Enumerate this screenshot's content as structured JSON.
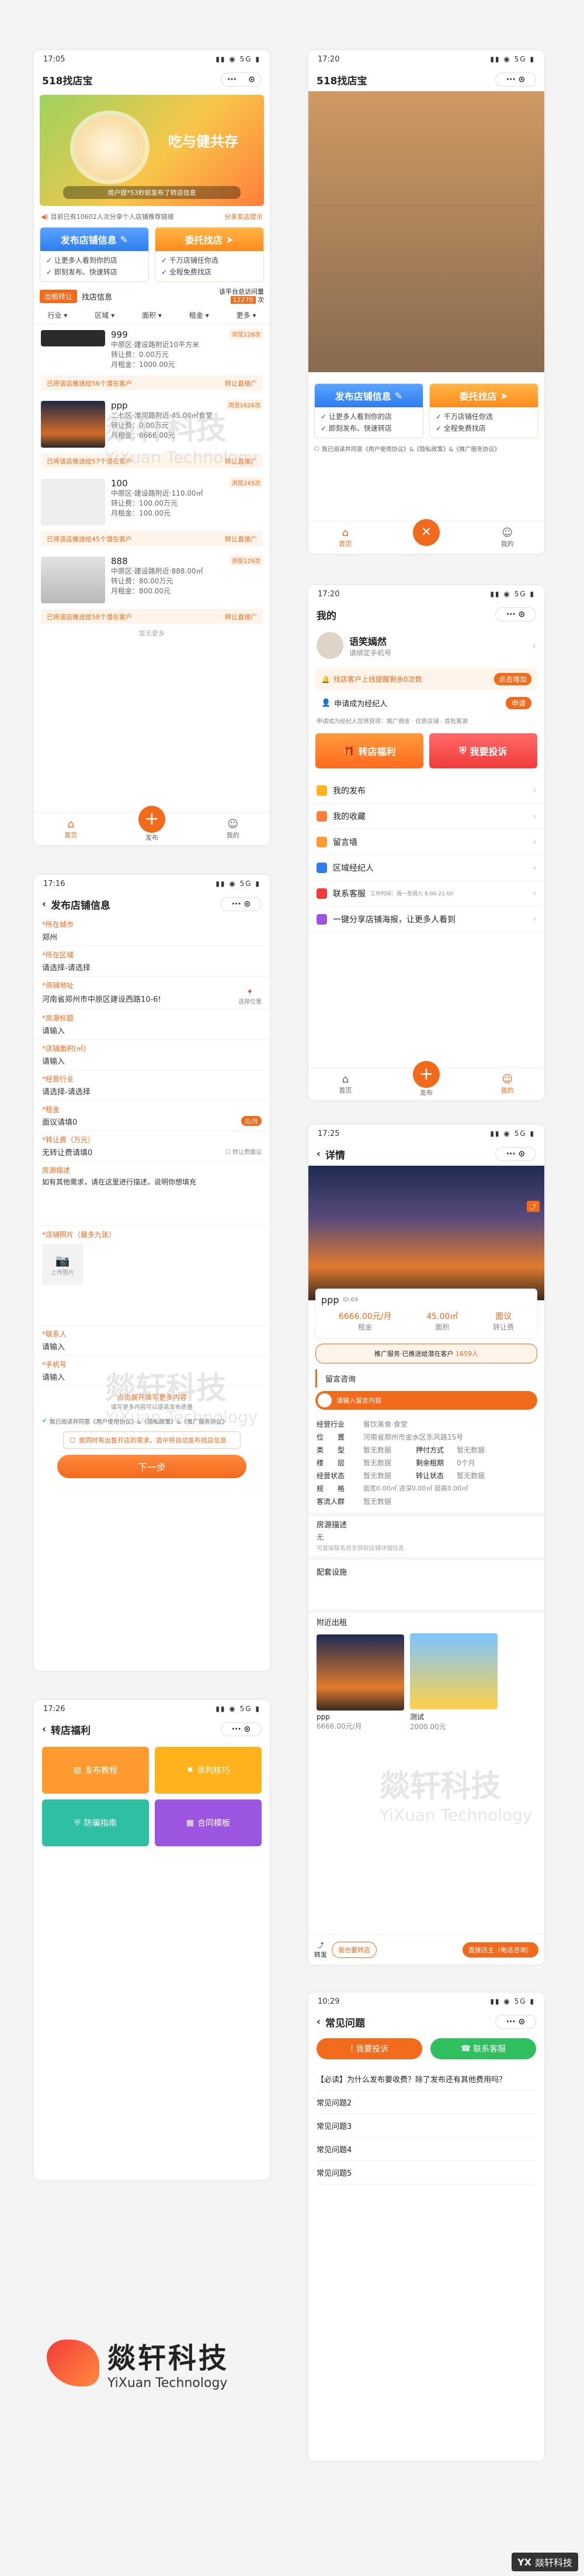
{
  "brand": {
    "name_cn": "燚轩科技",
    "name_en": "YiXuan Technology"
  },
  "colors": {
    "accent": "#f26a1b",
    "blue": "#2f7df0"
  },
  "s1": {
    "time": "17:05",
    "title": "518找店宝",
    "notice": "目前已有10602人次分享个人店铺推荐链接",
    "share_btn": "分享发店提示",
    "banner_text": "吃与健共存",
    "banner_sub": "用户提*53秒前发布了转店信息",
    "publish_title": "发布店铺信息",
    "publish_items": [
      "让更多人看到你的店",
      "即刻发布、快速转店"
    ],
    "entrust_title": "委托找店",
    "entrust_items": [
      "千万店铺任你选",
      "全程免费找店"
    ],
    "tabs": [
      "出租转让",
      "找店信息"
    ],
    "stat": "该平台总访问量",
    "stat_num": "12270",
    "stat_unit": "次",
    "filters": [
      "行业",
      "区域",
      "面积",
      "租金",
      "更多"
    ],
    "listings": [
      {
        "title": "999",
        "tag": "浏览128次",
        "lines": [
          "中原区·建设路附近10平方米",
          "转让费：0.00万元",
          "月租金：1000.00元"
        ],
        "tip": "已将该店推送给56个潜在客户",
        "tip_btn": "转让直接广"
      },
      {
        "title": "ppp",
        "tag": "浏览1626次",
        "lines": [
          "二七区·淮河路附近·45.00㎡食堂",
          "转让费：0.00万元",
          "月租金：6666.00元"
        ],
        "tip": "已将该店推送给57个潜在客户",
        "tip_btn": "转让直接广"
      },
      {
        "title": "100",
        "tag": "浏览245次",
        "lines": [
          "中原区·建设路附近·110.00㎡",
          "转让费：100.00万元",
          "月租金：100.00元"
        ],
        "tip": "已将该店推送给45个潜在客户",
        "tip_btn": "转让直接广"
      },
      {
        "title": "888",
        "tag": "浏览129次",
        "lines": [
          "中原区·建设路附近·888.00㎡",
          "转让费：80.00万元",
          "月租金：800.00元"
        ],
        "tip": "已将该店推送给58个潜在客户",
        "tip_btn": "转让直接广"
      }
    ],
    "more": "暂无更多",
    "tabbar": [
      "首页",
      "发布",
      "我的"
    ]
  },
  "s2": {
    "time": "17:20",
    "title": "518找店宝",
    "publish_title": "发布店铺信息",
    "publish_items": [
      "让更多人看到你的店",
      "即刻发布、快速转店"
    ],
    "entrust_title": "委托找店",
    "entrust_items": [
      "千万店铺任你选",
      "全程免费找店"
    ],
    "agree": "我已阅读并同意《用户使用协议》&《隐私政策》&《推广服务协议》",
    "tabbar": [
      "首页",
      "",
      "我的"
    ]
  },
  "s3": {
    "time": "17:20",
    "title": "我的",
    "username": "语笑嫣然",
    "usersub": "请绑定手机号",
    "alert": "找店客户上线提醒剩余0次数",
    "alert_btn": "点击增加",
    "agent": "申请成为经纪人",
    "agent_btn": "申请",
    "agent_sub": "申请成为经纪人您将获得：推广佣金 · 优质店铺 · 首批客源",
    "card1": "转店福利",
    "card2": "我要投诉",
    "menu": [
      "我的发布",
      "我的收藏",
      "留言墙",
      "区域经纪人",
      "联系客服",
      "一键分享店铺海报，让更多人看到"
    ],
    "service_hours": "工作时间：周一至周六 9:00-21:00",
    "tabbar": [
      "首页",
      "发布",
      "我的"
    ]
  },
  "s4": {
    "time": "17:16",
    "title": "发布店铺信息",
    "fields": [
      {
        "label": "*所在城市",
        "value": "郑州"
      },
      {
        "label": "*所在区域",
        "value": "请选择-请选择"
      },
      {
        "label": "*商铺地址",
        "value": "河南省郑州市中原区建设西路10-6!"
      },
      {
        "label": "*房源标题",
        "value": "请输入"
      },
      {
        "label": "*店铺面积(㎡)",
        "value": "请输入"
      },
      {
        "label": "*经营行业",
        "value": "请选择-请选择"
      },
      {
        "label": "*租金",
        "value": "面议请填0"
      },
      {
        "label": "*转让费（万元）",
        "value": "无转让费请填0"
      }
    ],
    "locate": "选择位置",
    "rent_unit": "元/月",
    "neg": "转让费面议",
    "desc_label": "房源描述",
    "desc_ph": "如有其他需求，请在这里进行描述，说明你想填充",
    "photo_label": "*店铺照片（最多九张）",
    "photo_btn": "上传图片",
    "contact_label": "*联系人",
    "contact_ph": "请输入",
    "phone_label": "*手机号",
    "phone_ph": "请输入",
    "expand": "点击展开填写更多内容",
    "expand_sub": "填写更多内容可以提高发布质量",
    "agree": "我已阅读并同意《用户使用协议》&《隐私政策》&《推广服务协议》",
    "sync": "我同时有出售开店的需求，选中将自动发布找店信息",
    "next": "下一步"
  },
  "s5": {
    "time": "17:25",
    "title": "详情",
    "name": "ppp",
    "id": "ID:69",
    "rent": "6666.00元/月",
    "rent_lbl": "租金",
    "area": "45.00㎡",
    "area_lbl": "面积",
    "fee": "面议",
    "fee_lbl": "转让费",
    "push": "推广服务·已推送给潜在客户",
    "push_num": "1659人",
    "section_msg": "留言咨询",
    "msg_ph": "请输入留言内容",
    "info": [
      [
        "经营行业",
        "餐饮美食·食堂"
      ],
      [
        "位　　置",
        "河南省郑州市金水区东风路15号"
      ],
      [
        "类　　型",
        "暂无数据"
      ],
      [
        "押付方式",
        "暂无数据"
      ],
      [
        "楼　　层",
        "暂无数据"
      ],
      [
        "剩余租期",
        "0个月"
      ],
      [
        "经营状态",
        "暂无数据"
      ],
      [
        "转让状态",
        "暂无数据"
      ],
      [
        "规　　格",
        "面宽0.00㎡ 进深0.00㎡ 层高0.00㎡"
      ],
      [
        "客流人群",
        "暂无数据"
      ]
    ],
    "desc_head": "房源描述",
    "desc": "无",
    "note": "可直接联系房东获取店铺详细信息",
    "facility": "配套设施",
    "nearby": "附近出租",
    "near": [
      {
        "title": "ppp",
        "price": "6666.00元/月"
      },
      {
        "title": "测试",
        "price": "2000.00元"
      }
    ],
    "act1": "转发",
    "act2": "我也要转店",
    "act3": "直接店主（电话咨询）",
    "follow": "关注"
  },
  "s6": {
    "time": "17:26",
    "title": "转店福利",
    "cards": [
      {
        "label": "发布教程",
        "color": "#ff9b2e"
      },
      {
        "label": "谈判技巧",
        "color": "#ffb21c"
      },
      {
        "label": "防骗指南",
        "color": "#2fbfa2"
      },
      {
        "label": "合同模板",
        "color": "#9b55e0"
      }
    ]
  },
  "s7": {
    "time": "10:29",
    "title": "常见问题",
    "btn1": "我要投诉",
    "btn2": "联系客服",
    "faq": [
      "【必读】为什么发布要收费？除了发布还有其他费用吗？",
      "常见问题2",
      "常见问题3",
      "常见问题4",
      "常见问题5"
    ]
  }
}
